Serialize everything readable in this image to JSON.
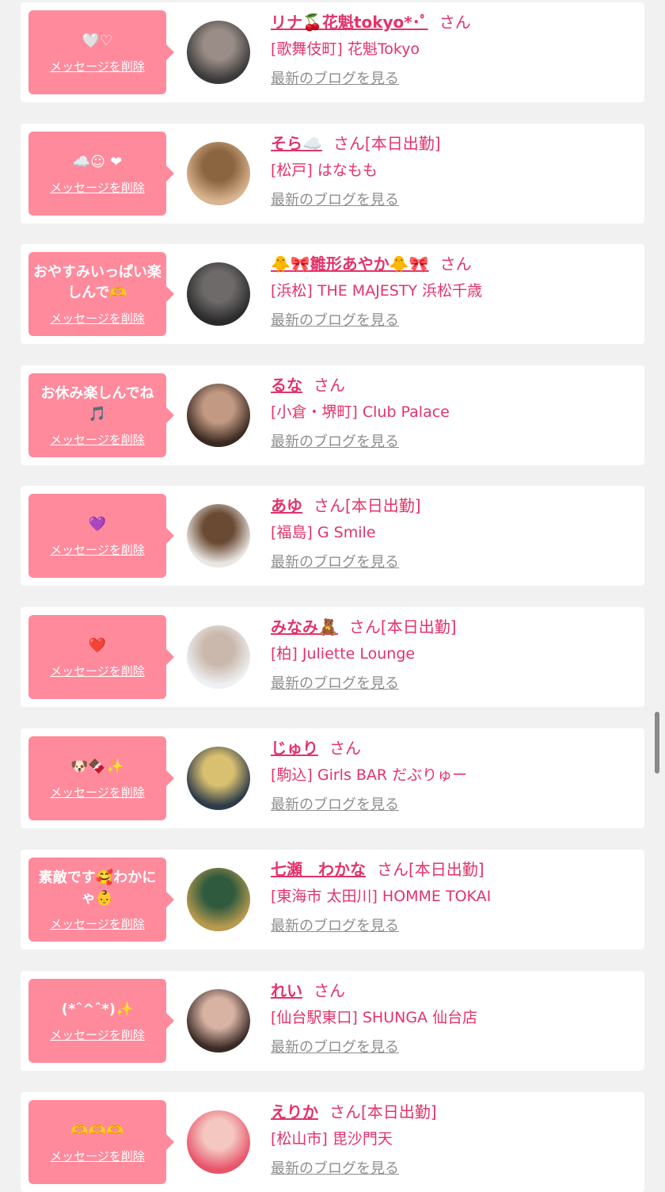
{
  "delete_label": "メッセージを削除",
  "blog_label": "最新のブログを見る",
  "honorific": "さん",
  "items": [
    {
      "message": "🤍♡",
      "name": "リナ🍒花魁tokyo*･ﾟ",
      "status": "",
      "shop": "[歌舞伎町] 花魁Tokyo",
      "avatar_colors": [
        "#3a3a3a",
        "#9a8c86"
      ]
    },
    {
      "message": "☁️☺︎ ❤︎",
      "name": "そら☁️",
      "status": "[本日出勤]",
      "shop": "[松戸] はなもも",
      "avatar_colors": [
        "#d9b58f",
        "#8b6440"
      ]
    },
    {
      "message": "おやすみいっぱい楽しんで🫶",
      "name": "🐥🎀雛形あやか🐥🎀",
      "status": "",
      "shop": "[浜松] THE MAJESTY 浜松千歳",
      "avatar_colors": [
        "#2b2b2b",
        "#6e6a6a"
      ]
    },
    {
      "message": "お休み楽しんでね🎵",
      "name": "るな",
      "status": "",
      "shop": "[小倉・堺町] Club Palace",
      "avatar_colors": [
        "#3b2a22",
        "#c29a83"
      ]
    },
    {
      "message": "💜",
      "name": "あゆ",
      "status": "[本日出勤]",
      "shop": "[福島] G Smile",
      "avatar_colors": [
        "#eae6e2",
        "#6a4a33"
      ]
    },
    {
      "message": "❤️",
      "name": "みなみ🧸",
      "status": "[本日出勤]",
      "shop": "[柏] Juliette Lounge",
      "avatar_colors": [
        "#eef0f2",
        "#c9b8ab"
      ]
    },
    {
      "message": "🐶🍫✨",
      "name": "じゅり",
      "status": "",
      "shop": "[駒込] Girls BAR だぶりゅー",
      "avatar_colors": [
        "#2c3a4a",
        "#d8c070"
      ]
    },
    {
      "message": "素敵です🥰わかにゃ👶",
      "name": "七瀬　わかな",
      "status": "[本日出勤]",
      "shop": "[東海市 太田川] HOMME TOKAI",
      "avatar_colors": [
        "#b89a4e",
        "#2f5a3e"
      ]
    },
    {
      "message": "(*ˆ^ˆ*)✨",
      "name": "れい",
      "status": "",
      "shop": "[仙台駅東口] SHUNGA 仙台店",
      "avatar_colors": [
        "#3a2a26",
        "#d8b3a3"
      ]
    },
    {
      "message": "🫶🫶🫶",
      "name": "えりか",
      "status": "[本日出勤]",
      "shop": "[松山市] 毘沙門天",
      "avatar_colors": [
        "#e8536a",
        "#f4c7c0"
      ]
    }
  ]
}
